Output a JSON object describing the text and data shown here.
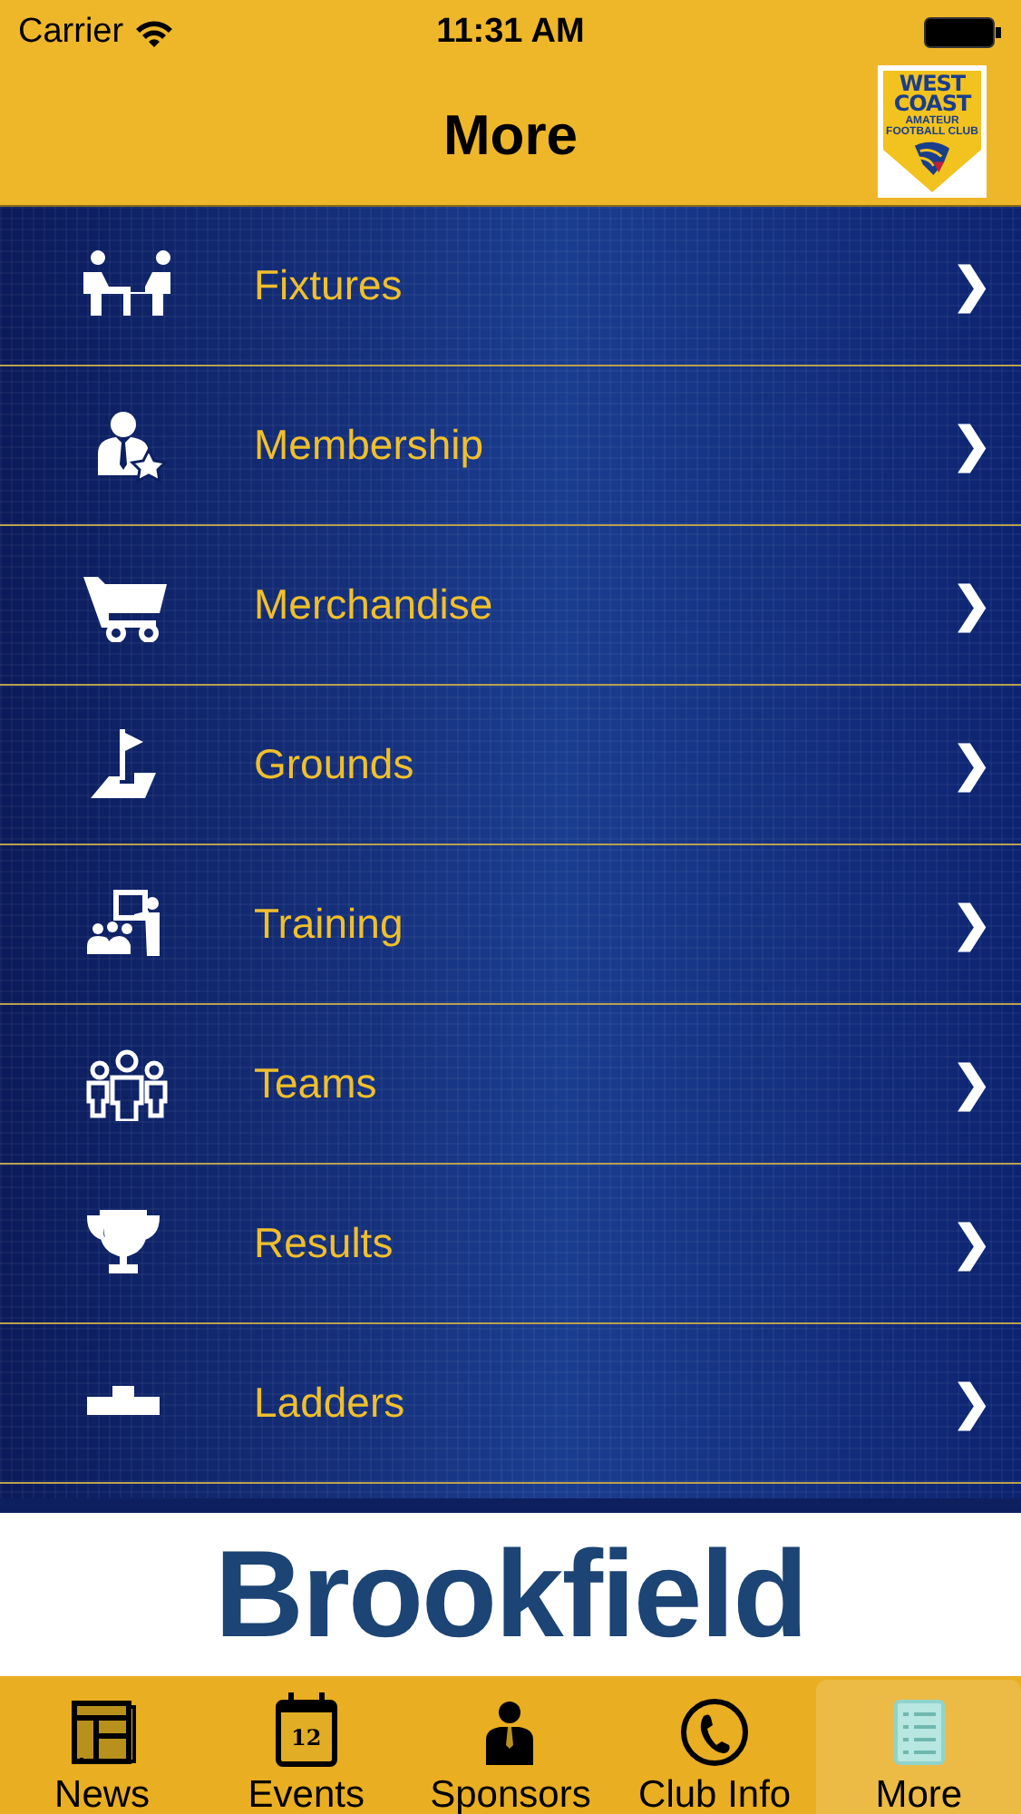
{
  "status_bar": {
    "carrier": "Carrier",
    "time": "11:31 AM"
  },
  "header": {
    "title": "More",
    "logo": {
      "lines": [
        "WEST",
        "COAST"
      ],
      "tagline": "AMATEUR FOOTBALL CLUB"
    }
  },
  "menu": [
    {
      "label": "Fixtures",
      "arrow": "❯"
    },
    {
      "label": "Membership",
      "arrow": "❯"
    },
    {
      "label": "Merchandise",
      "arrow": "❯"
    },
    {
      "label": "Grounds",
      "arrow": "❯"
    },
    {
      "label": "Training",
      "arrow": "❯"
    },
    {
      "label": "Teams",
      "arrow": "❯"
    },
    {
      "label": "Results",
      "arrow": "❯"
    },
    {
      "label": "Ladders",
      "arrow": "❯"
    }
  ],
  "sponsor_banner": {
    "text": "Brookfield"
  },
  "tab_bar": [
    {
      "label": "News",
      "selected": false
    },
    {
      "label": "Events",
      "selected": false,
      "badge": "12"
    },
    {
      "label": "Sponsors",
      "selected": false
    },
    {
      "label": "Club Info",
      "selected": false
    },
    {
      "label": "More",
      "selected": true
    }
  ]
}
